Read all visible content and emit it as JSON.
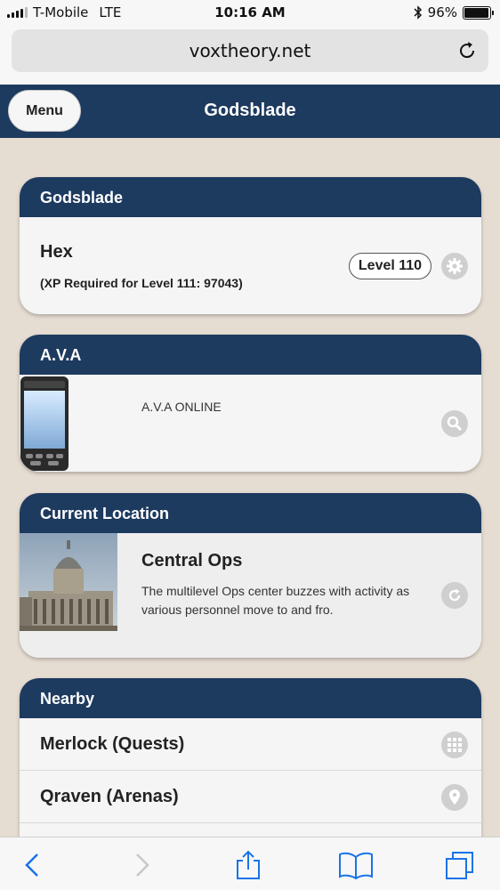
{
  "status_bar": {
    "carrier": "T-Mobile",
    "network": "LTE",
    "time": "10:16 AM",
    "battery": "96%",
    "battery_level": 0.96
  },
  "browser": {
    "url": "voxtheory.net"
  },
  "app_header": {
    "menu_label": "Menu",
    "title": "Godsblade"
  },
  "character_card": {
    "header": "Godsblade",
    "name": "Hex",
    "xp_text": "(XP Required for Level 111: 97043)",
    "level": "Level 110"
  },
  "ava_card": {
    "header": "A.V.A",
    "status": "A.V.A ONLINE"
  },
  "location_card": {
    "header": "Current Location",
    "name": "Central Ops",
    "description": "The multilevel Ops center buzzes with activity as various personnel move to and fro."
  },
  "nearby_card": {
    "header": "Nearby",
    "items": [
      {
        "label": "Merlock (Quests)",
        "icon": "grid-icon"
      },
      {
        "label": "Qraven (Arenas)",
        "icon": "map-pin-icon"
      }
    ]
  },
  "colors": {
    "header_blue": "#1d3a5f",
    "background": "#e6ddd2"
  }
}
